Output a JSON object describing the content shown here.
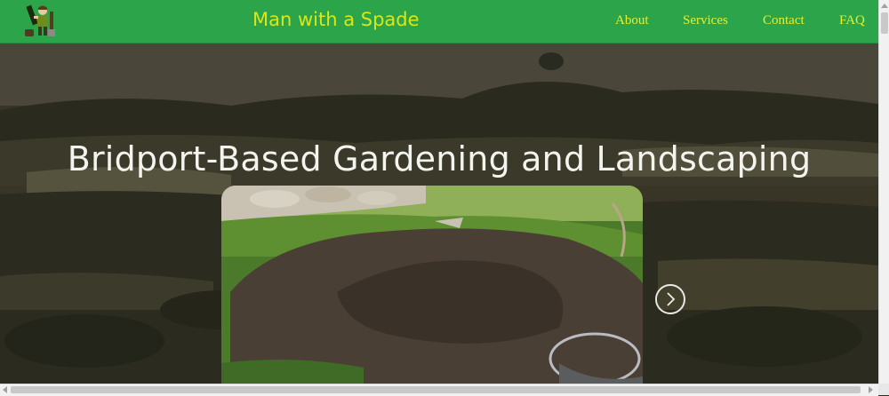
{
  "header": {
    "brand": "Man with a Spade",
    "nav": [
      "About",
      "Services",
      "Contact",
      "FAQ"
    ]
  },
  "hero": {
    "title": "Bridport-Based Gardening and Landscaping"
  },
  "colors": {
    "navbar": "#2ca54a",
    "brand_text": "#d8e61a",
    "nav_text": "#e8ee2a",
    "hero_overlay": "#2f2c22",
    "title_text": "#f4f4ef"
  },
  "icons": {
    "logo": "gardener-logo",
    "carousel_next": "chevron-right-icon"
  }
}
